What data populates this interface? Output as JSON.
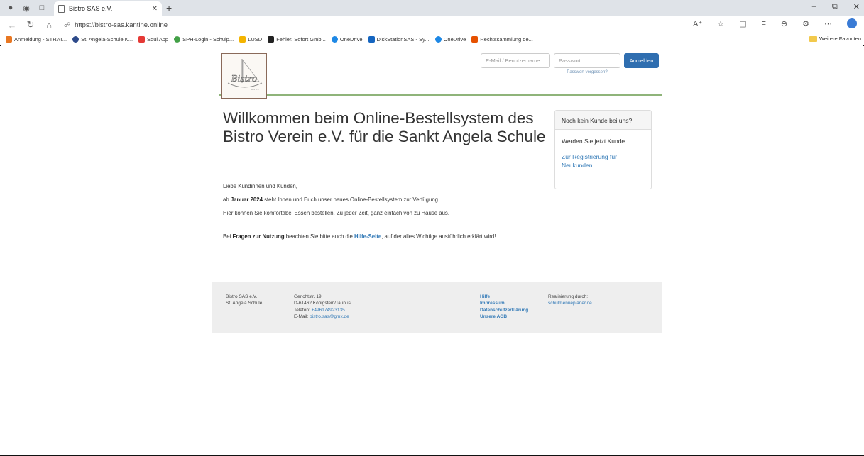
{
  "browser": {
    "tab_title": "Bistro SAS e.V.",
    "url": "https://bistro-sas.kantine.online",
    "favorites": [
      {
        "label": "Anmeldung - STRAT...",
        "color": "#e87722"
      },
      {
        "label": "St. Angela-Schule K...",
        "color": "#2d4a8a"
      },
      {
        "label": "Sdui App",
        "color": "#e53935"
      },
      {
        "label": "SPH-Login - Schulp...",
        "color": "#43a047"
      },
      {
        "label": "LUSD",
        "color": "#f4b400"
      },
      {
        "label": "Fehler. Sofort Gmb...",
        "color": "#222222"
      },
      {
        "label": "OneDrive",
        "color": "#1e88e5"
      },
      {
        "label": "DiskStationSAS - Sy...",
        "color": "#1565c0"
      },
      {
        "label": "OneDrive",
        "color": "#1e88e5"
      },
      {
        "label": "Rechtssammlung de...",
        "color": "#e65100"
      }
    ],
    "other_favorites": "Weitere Favoriten"
  },
  "header": {
    "email_placeholder": "E-Mail / Benutzername",
    "password_placeholder": "Passwort",
    "forgot_password": "Passwort vergessen?",
    "login_button": "Anmelden"
  },
  "main": {
    "welcome_heading": "Willkommen beim Online-Bestellsystem des Bistro Verein e.V. für die Sankt Angela Schule",
    "greeting": "Liebe Kundinnen und Kunden,",
    "line1_pre": "ab ",
    "line1_bold": "Januar 2024",
    "line1_post": " steht Ihnen und Euch unser neues Online-Bestellsystem zur Verfügung.",
    "line2": "Hier können Sie komfortabel Essen bestellen. Zu jeder Zeit, ganz einfach von zu Hause aus.",
    "help_pre": "Bei ",
    "help_bold": "Fragen zur Nutzung",
    "help_mid": " beachten Sie bitte auch die ",
    "help_link": "Hilfe-Seite",
    "help_post": ", auf der alles Wichtige ausführlich erklärt wird!"
  },
  "sidebox": {
    "heading": "Noch kein Kunde bei uns?",
    "text": "Werden Sie jetzt Kunde.",
    "link": "Zur Registrierung für Neukunden"
  },
  "footer": {
    "org_name": "Bistro SAS e.V.",
    "org_school": "St. Angela Schule",
    "street": "Gerichtstr. 19",
    "city": "D-61462 Königstein/Taunus",
    "phone_label": "Telefon: ",
    "phone": "+496174923135",
    "email_label": "E-Mail: ",
    "email": "bistro.sas@gmx.de",
    "links": [
      "Hilfe",
      "Impressum",
      "Datenschutzerklärung",
      "Unsere AGB"
    ],
    "realized_by": "Realisierung durch:",
    "realized_link": "schulmenueplaner.de"
  }
}
